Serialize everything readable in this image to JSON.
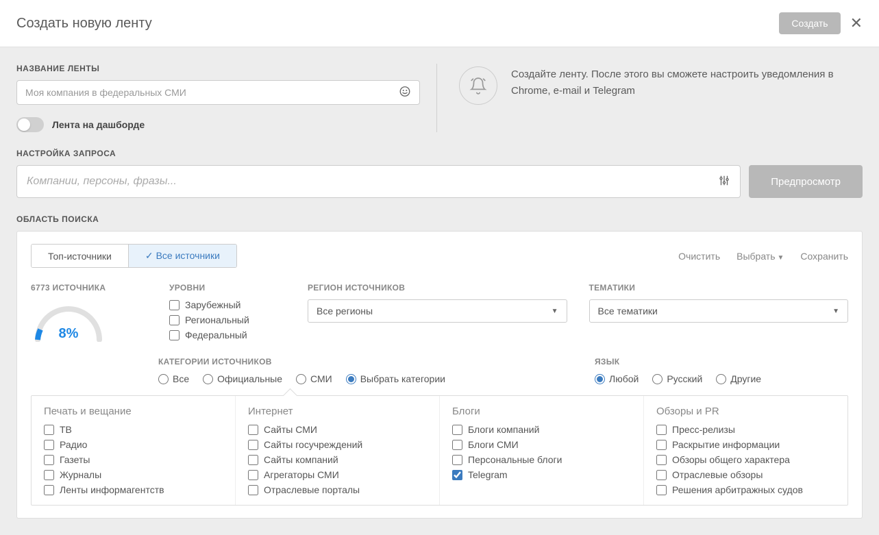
{
  "header": {
    "title": "Создать новую ленту",
    "create_button": "Создать"
  },
  "feed_name": {
    "label": "НАЗВАНИЕ ЛЕНТЫ",
    "placeholder": "Моя компания в федеральных СМИ",
    "toggle_label": "Лента на дашборде"
  },
  "hint": {
    "text": "Создайте ленту. После этого вы сможете настроить уведомления в Chrome, e-mail и Telegram"
  },
  "query": {
    "label": "НАСТРОЙКА ЗАПРОСА",
    "placeholder": "Компании, персоны, фразы...",
    "preview_button": "Предпросмотр"
  },
  "search_area": {
    "label": "ОБЛАСТЬ ПОИСКА",
    "tabs": {
      "top": "Топ-источники",
      "all": "Все источники"
    },
    "actions": {
      "clear": "Очистить",
      "select": "Выбрать",
      "save": "Сохранить"
    },
    "sources_count_label": "6773 ИСТОЧНИКА",
    "percentage": "8%",
    "levels": {
      "label": "УРОВНИ",
      "foreign": "Зарубежный",
      "regional": "Региональный",
      "federal": "Федеральный"
    },
    "region": {
      "label": "РЕГИОН ИСТОЧНИКОВ",
      "value": "Все регионы"
    },
    "topics": {
      "label": "ТЕМАТИКИ",
      "value": "Все тематики"
    },
    "categories": {
      "label": "КАТЕГОРИИ ИСТОЧНИКОВ",
      "all": "Все",
      "official": "Официальные",
      "media": "СМИ",
      "select_cats": "Выбрать категории"
    },
    "language": {
      "label": "ЯЗЫК",
      "any": "Любой",
      "russian": "Русский",
      "other": "Другие"
    },
    "cat_panel": {
      "print": {
        "title": "Печать и вещание",
        "tv": "ТВ",
        "radio": "Радио",
        "newspapers": "Газеты",
        "magazines": "Журналы",
        "agencies": "Ленты информагентств"
      },
      "internet": {
        "title": "Интернет",
        "media_sites": "Сайты СМИ",
        "gov_sites": "Сайты госучреждений",
        "company_sites": "Сайты компаний",
        "aggregators": "Агрегаторы СМИ",
        "portals": "Отраслевые порталы"
      },
      "blogs": {
        "title": "Блоги",
        "company_blogs": "Блоги компаний",
        "media_blogs": "Блоги СМИ",
        "personal_blogs": "Персональные блоги",
        "telegram": "Telegram"
      },
      "reviews": {
        "title": "Обзоры и PR",
        "press": "Пресс-релизы",
        "disclosure": "Раскрытие информации",
        "general_reviews": "Обзоры общего характера",
        "industry_reviews": "Отраслевые обзоры",
        "court": "Решения арбитражных судов"
      }
    }
  }
}
